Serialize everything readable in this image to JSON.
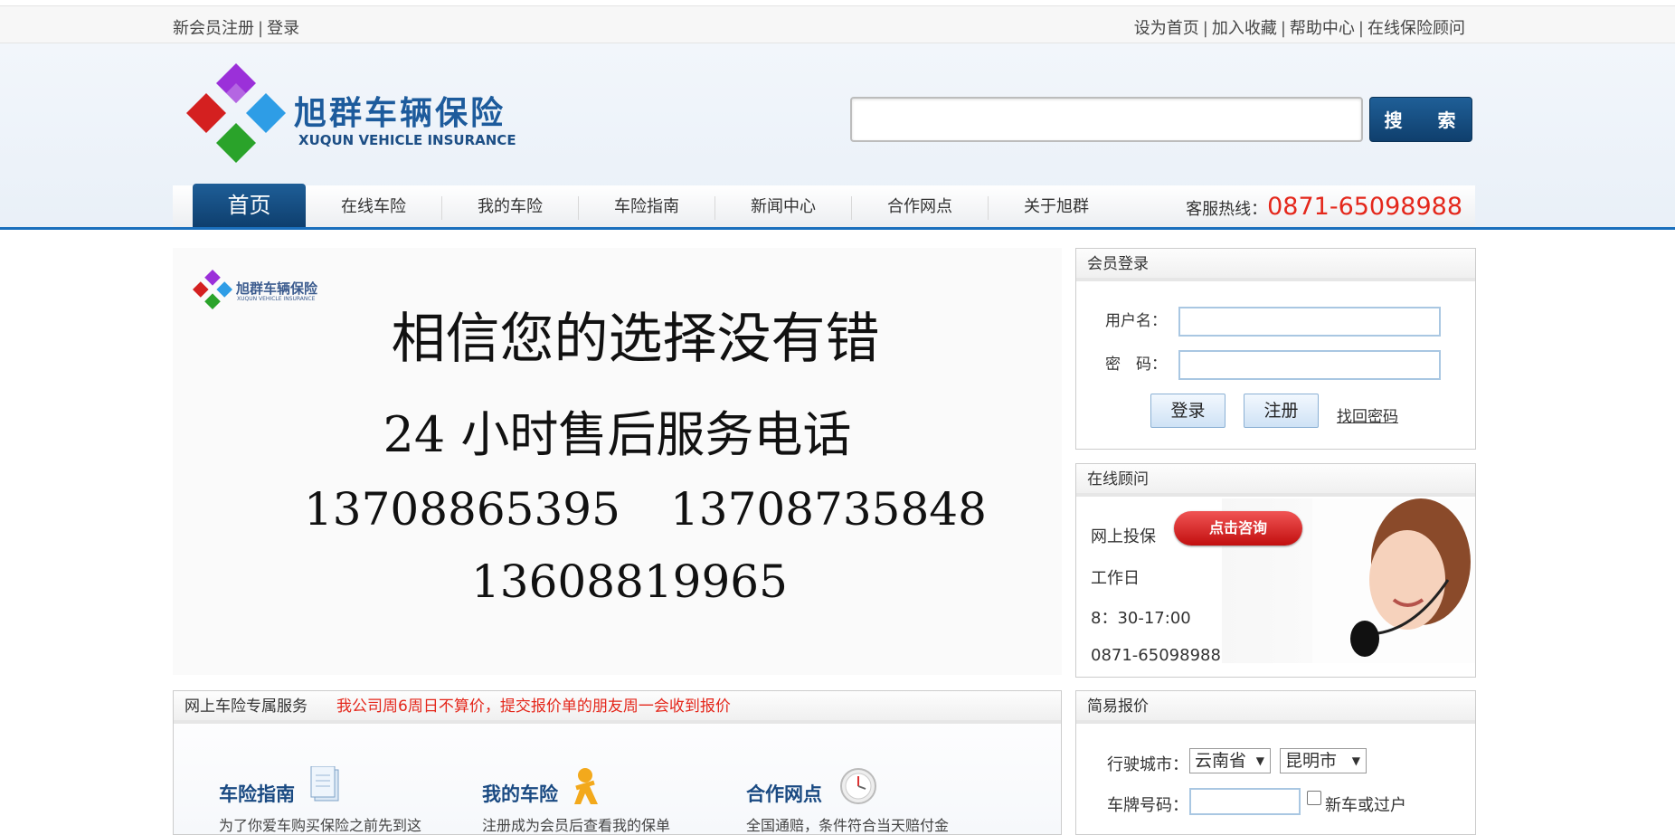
{
  "topbar": {
    "register": "新会员注册",
    "login": "登录",
    "set_home": "设为首页",
    "favorite": "加入收藏",
    "help": "帮助中心",
    "advisor": "在线保险顾问",
    "separator": "|"
  },
  "header": {
    "brand_cn": "旭群车辆保险",
    "brand_en": "XUQUN VEHICLE INSURANCE",
    "search_placeholder": "",
    "search_button": "搜 索"
  },
  "nav": {
    "items": [
      "首页",
      "在线车险",
      "我的车险",
      "车险指南",
      "新闻中心",
      "合作网点",
      "关于旭群"
    ],
    "hotline_label": "客服热线：",
    "hotline_number": "0871-65098988"
  },
  "banner": {
    "logo_text": "旭群车辆保险",
    "logo_sub": "XUQUN VEHICLE INSURANCE",
    "slogan": "相信您的选择没有错",
    "service_title": "24 小时售后服务电话",
    "phones": [
      "13708865395",
      "13708735848",
      "13608819965"
    ]
  },
  "login_panel": {
    "title": "会员登录",
    "username_label": "用户名：",
    "password_label": "密　码：",
    "login_button": "登录",
    "register_button": "注册",
    "forgot_link": "找回密码"
  },
  "advisor_panel": {
    "title": "在线顾问",
    "online_insure": "网上投保",
    "consult_button": "点击咨询",
    "workday": "工作日",
    "hours": "8：30-17:00",
    "phone": "0871-65098988"
  },
  "service_panel": {
    "title": "网上车险专属服务",
    "notice": "我公司周6周日不算价，提交报价单的朋友周一会收到报价",
    "items": [
      {
        "title": "车险指南",
        "desc": "为了你爱车购买保险之前先到这"
      },
      {
        "title": "我的车险",
        "desc": "注册成为会员后查看我的保单"
      },
      {
        "title": "合作网点",
        "desc": "全国通赔，条件符合当天赔付金"
      }
    ]
  },
  "quote_panel": {
    "title": "简易报价",
    "city_label": "行驶城市：",
    "province": "云南省",
    "city": "昆明市",
    "plate_label": "车牌号码：",
    "new_car_label": "新车或过户"
  },
  "colors": {
    "brand_blue": "#1d5b9c",
    "nav_blue": "#0e3e6d",
    "hotline_red": "#e4271b"
  }
}
